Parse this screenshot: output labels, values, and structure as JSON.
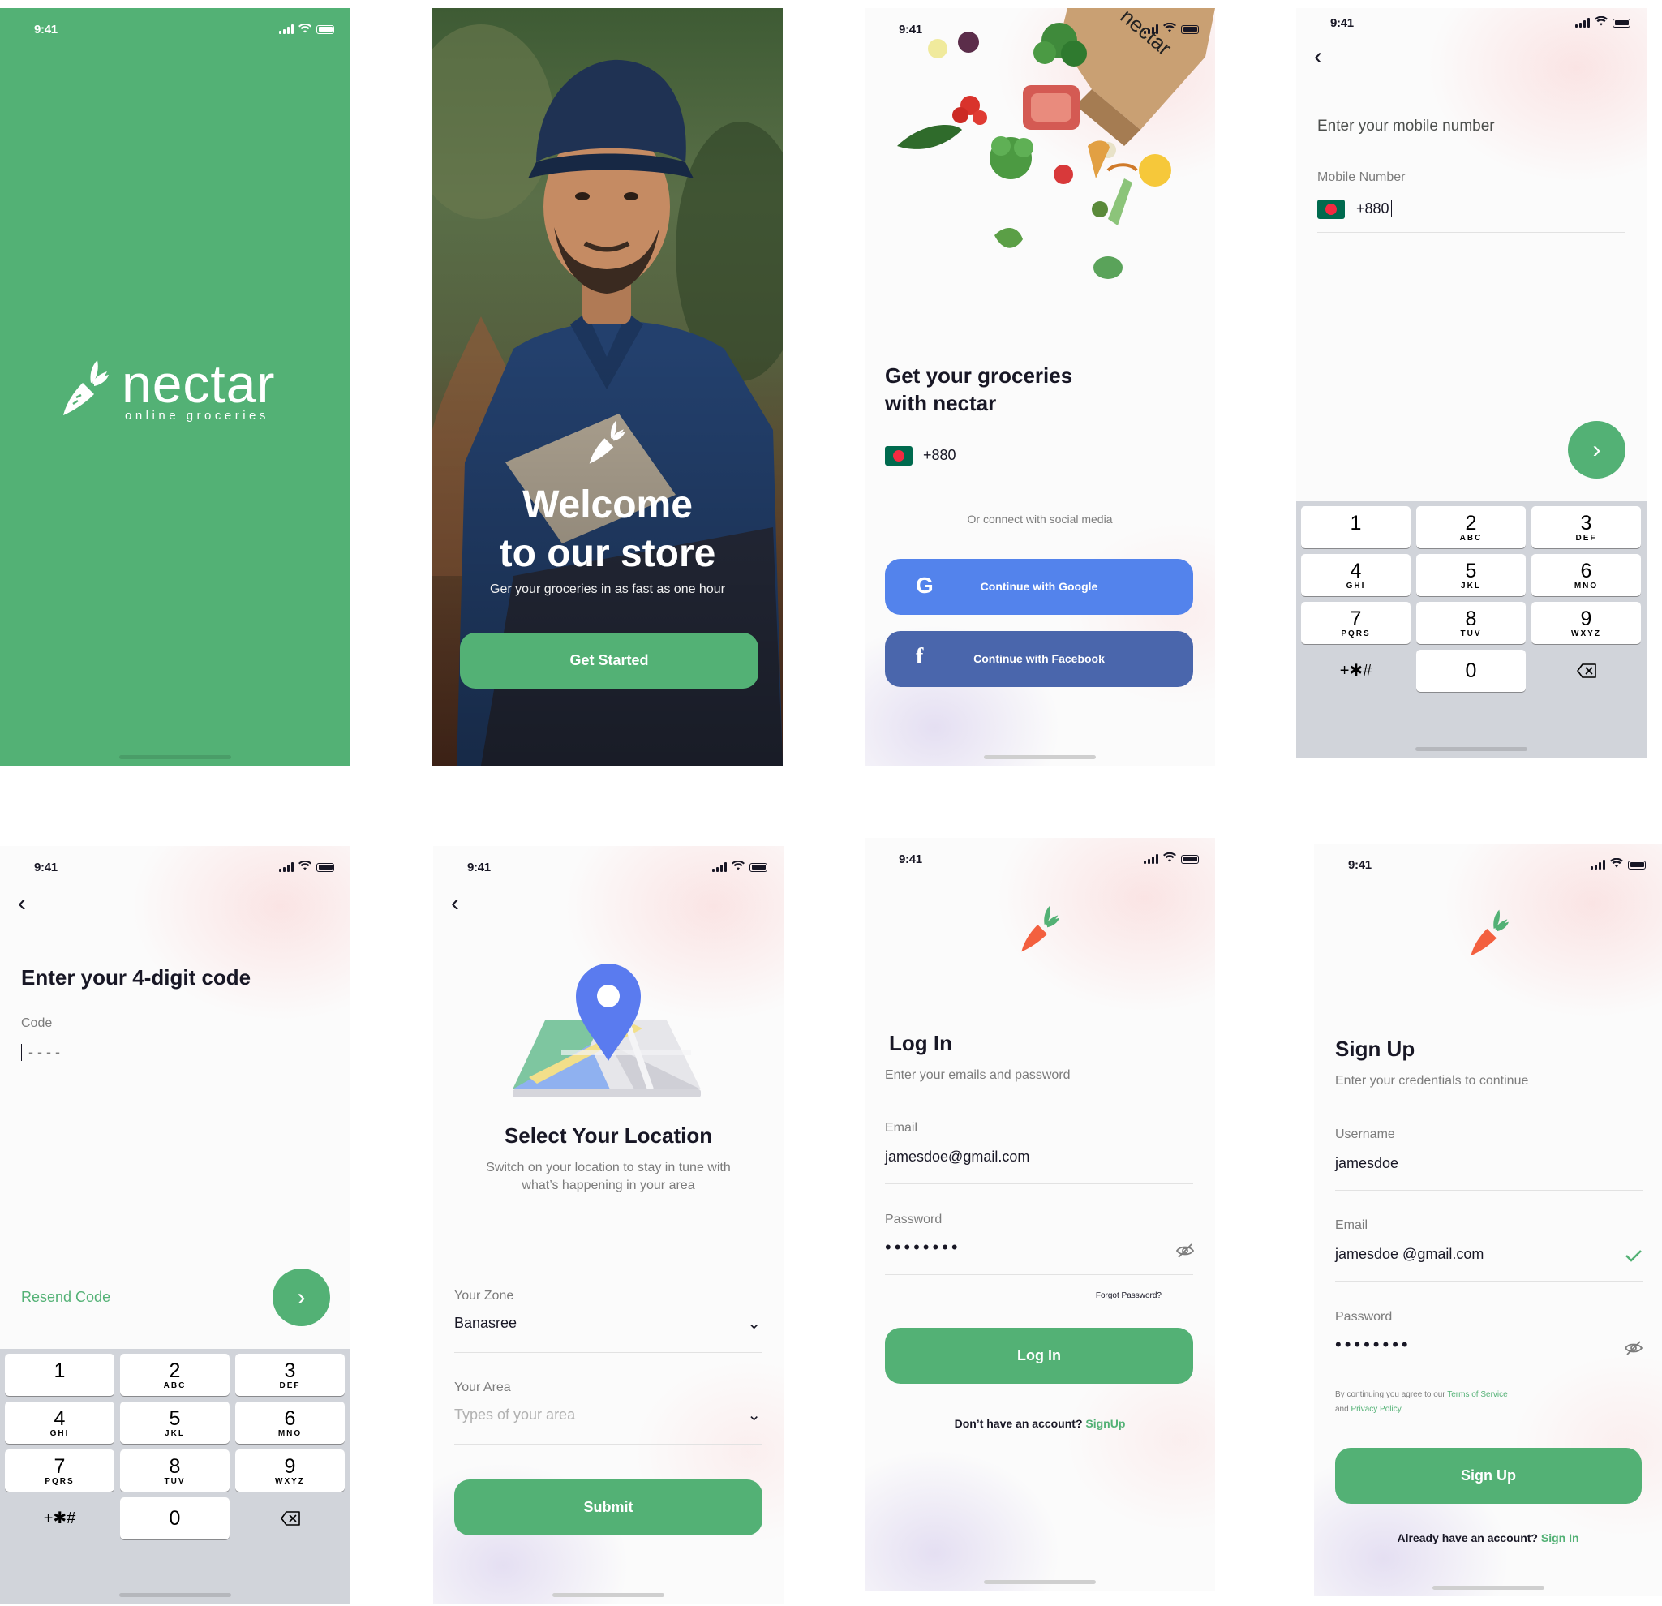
{
  "status_time": "9:41",
  "splash": {
    "brand": "nectar",
    "tagline": "online groceries"
  },
  "welcome": {
    "title_line1": "Welcome",
    "title_line2": "to our store",
    "subtitle": "Ger your groceries in as fast as one hour",
    "cta": "Get Started"
  },
  "signin": {
    "bag_label": "nectar",
    "title_line1": "Get your groceries",
    "title_line2": "with nectar",
    "country_code": "+880",
    "social_text": "Or connect with social media",
    "google_label": "Continue with Google",
    "facebook_label": "Continue with Facebook"
  },
  "mobile": {
    "title": "Enter your mobile number",
    "field_label": "Mobile Number",
    "country_code": "+880"
  },
  "keypad": {
    "keys": [
      {
        "digit": "1",
        "letters": ""
      },
      {
        "digit": "2",
        "letters": "ABC"
      },
      {
        "digit": "3",
        "letters": "DEF"
      },
      {
        "digit": "4",
        "letters": "GHI"
      },
      {
        "digit": "5",
        "letters": "JKL"
      },
      {
        "digit": "6",
        "letters": "MNO"
      },
      {
        "digit": "7",
        "letters": "PQRS"
      },
      {
        "digit": "8",
        "letters": "TUV"
      },
      {
        "digit": "9",
        "letters": "WXYZ"
      },
      {
        "digit": "0",
        "letters": ""
      }
    ],
    "symbols": "+✱#"
  },
  "code": {
    "title": "Enter your 4-digit code",
    "field_label": "Code",
    "placeholder": "- - - -",
    "resend": "Resend Code"
  },
  "location": {
    "title": "Select Your Location",
    "subtitle_line1": "Switch on your location to stay in tune with",
    "subtitle_line2": "what’s happening in your area",
    "zone_label": "Your Zone",
    "zone_value": "Banasree",
    "area_label": "Your Area",
    "area_placeholder": "Types of your area",
    "submit": "Submit"
  },
  "login": {
    "title": "Log In",
    "subtitle": "Enter your emails and password",
    "email_label": "Email",
    "email_value": "jamesdoe@gmail.com",
    "password_label": "Password",
    "password_mask": "••••••••",
    "forgot": "Forgot Password?",
    "button": "Log In",
    "no_account": "Don’t have an account?",
    "signup_link": "SignUp"
  },
  "signup": {
    "title": "Sign Up",
    "subtitle": "Enter your credentials to continue",
    "username_label": "Username",
    "username_value": "jamesdoe",
    "email_label": "Email",
    "email_value": "jamesdoe @gmail.com",
    "password_label": "Password",
    "password_mask": "••••••••",
    "terms_prefix": "By continuing you agree to our ",
    "terms_link": "Terms of Service",
    "terms_and": "and ",
    "privacy_link": "Privacy Policy.",
    "button": "Sign Up",
    "have_account": "Already have an account?",
    "signin_link": "Sign In"
  },
  "colors": {
    "primary": "#53b175",
    "google": "#5383ec",
    "facebook": "#4a66ac",
    "carrot": "#f3603f",
    "text_dark": "#181725",
    "text_gray": "#7c7c7c"
  }
}
